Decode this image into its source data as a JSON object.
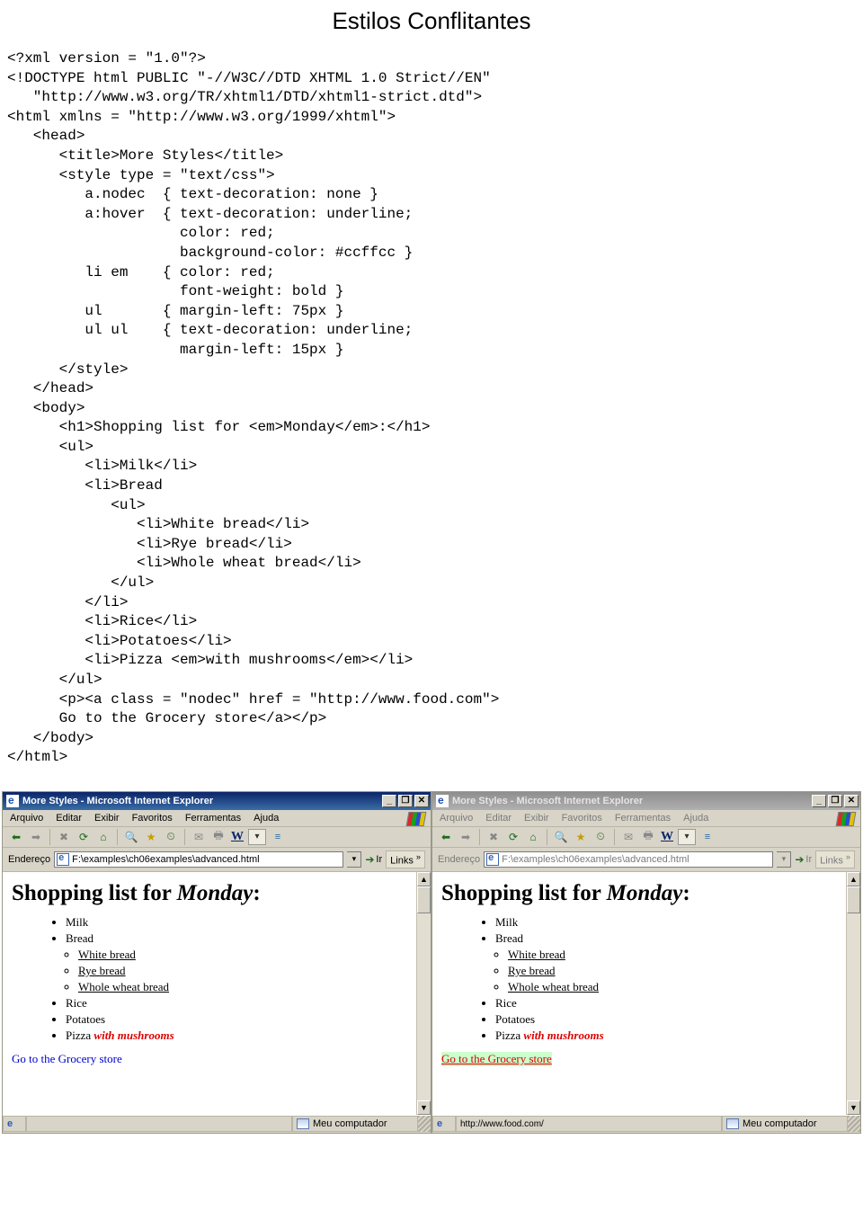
{
  "title": "Estilos Conflitantes",
  "code": "<?xml version = \"1.0\"?>\n<!DOCTYPE html PUBLIC \"-//W3C//DTD XHTML 1.0 Strict//EN\"\n   \"http://www.w3.org/TR/xhtml1/DTD/xhtml1-strict.dtd\">\n<html xmlns = \"http://www.w3.org/1999/xhtml\">\n   <head>\n      <title>More Styles</title>\n      <style type = \"text/css\">\n         a.nodec  { text-decoration: none }\n         a:hover  { text-decoration: underline;\n                    color: red;\n                    background-color: #ccffcc }\n         li em    { color: red;\n                    font-weight: bold }\n         ul       { margin-left: 75px }\n         ul ul    { text-decoration: underline;\n                    margin-left: 15px }\n      </style>\n   </head>\n   <body>\n      <h1>Shopping list for <em>Monday</em>:</h1>\n      <ul>\n         <li>Milk</li>\n         <li>Bread\n            <ul>\n               <li>White bread</li>\n               <li>Rye bread</li>\n               <li>Whole wheat bread</li>\n            </ul>\n         </li>\n         <li>Rice</li>\n         <li>Potatoes</li>\n         <li>Pizza <em>with mushrooms</em></li>\n      </ul>\n      <p><a class = \"nodec\" href = \"http://www.food.com\">\n      Go to the Grocery store</a></p>\n   </body>\n</html>",
  "browser": {
    "title": "More Styles - Microsoft Internet Explorer",
    "menus": [
      "Arquivo",
      "Editar",
      "Exibir",
      "Favoritos",
      "Ferramentas",
      "Ajuda"
    ],
    "address_label": "Endereço",
    "address_value": "F:\\examples\\ch06examples\\advanced.html",
    "go_label": "Ir",
    "links_label": "Links",
    "status_left_computer": "Meu computador",
    "status_right_url": "http://www.food.com/"
  },
  "rendered": {
    "heading_prefix": "Shopping list for ",
    "heading_em": "Monday",
    "heading_suffix": ":",
    "items": {
      "milk": "Milk",
      "bread": "Bread",
      "white_bread": "White bread",
      "rye_bread": "Rye bread",
      "whole_wheat": "Whole wheat bread",
      "rice": "Rice",
      "potatoes": "Potatoes",
      "pizza": "Pizza ",
      "pizza_em": "with mushrooms"
    },
    "link_text": "Go to the Grocery store"
  }
}
